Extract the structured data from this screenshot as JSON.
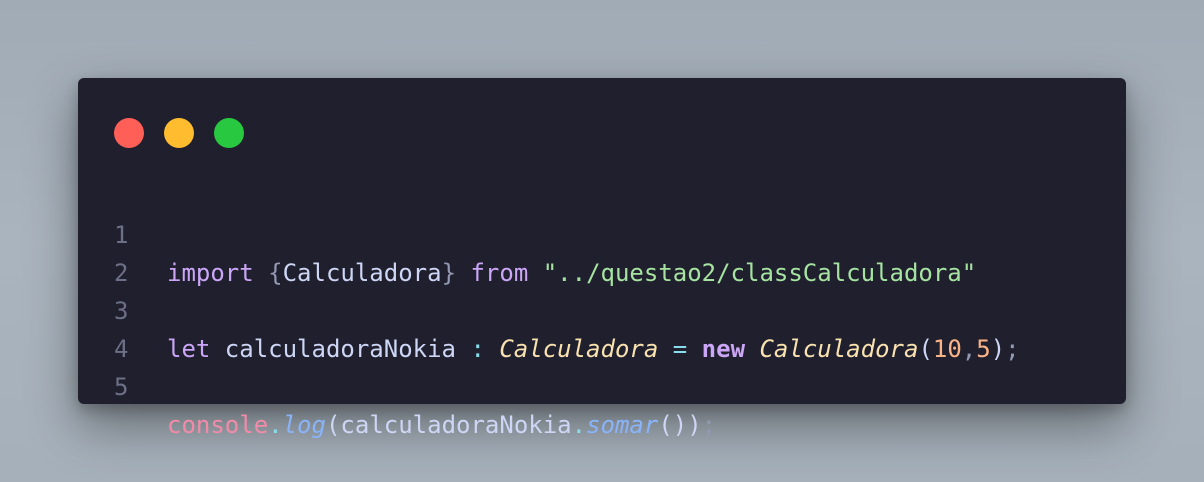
{
  "window": {
    "controls": [
      {
        "name": "close",
        "color": "#ff5f57"
      },
      {
        "name": "minimize",
        "color": "#febc2e"
      },
      {
        "name": "maximize",
        "color": "#28c840"
      }
    ]
  },
  "colors": {
    "background": "#1f1f2e",
    "keyword": "#cba6f7",
    "string": "#a6e3a1",
    "type": "#f9e2af",
    "number": "#fab387",
    "function": "#89b4fa",
    "object": "#f38ba8",
    "line_number": "#6c7086"
  },
  "code": {
    "lines": [
      {
        "number": "1",
        "tokens": {
          "t1": "import",
          "t2": " ",
          "t3": "{",
          "t4": "Calculadora",
          "t5": "}",
          "t6": " ",
          "t7": "from",
          "t8": " ",
          "t9": "\"../questao2/classCalculadora\""
        }
      },
      {
        "number": "2"
      },
      {
        "number": "3",
        "tokens": {
          "t1": "let",
          "t2": " calculadoraNokia ",
          "t3": ":",
          "t4": " ",
          "t5": "Calculadora",
          "t6": " ",
          "t7": "=",
          "t8": " ",
          "t9": "new",
          "t10": " ",
          "t11": "Calculadora",
          "t12": "(",
          "t13": "10",
          "t14": ",",
          "t15": "5",
          "t16": ")",
          "t17": ";"
        }
      },
      {
        "number": "4"
      },
      {
        "number": "5",
        "tokens": {
          "t1": "console",
          "t2": ".",
          "t3": "log",
          "t4": "(",
          "t5": "calculadoraNokia",
          "t6": ".",
          "t7": "somar",
          "t8": "()",
          "t9": ")",
          "t10": ";"
        }
      }
    ]
  }
}
